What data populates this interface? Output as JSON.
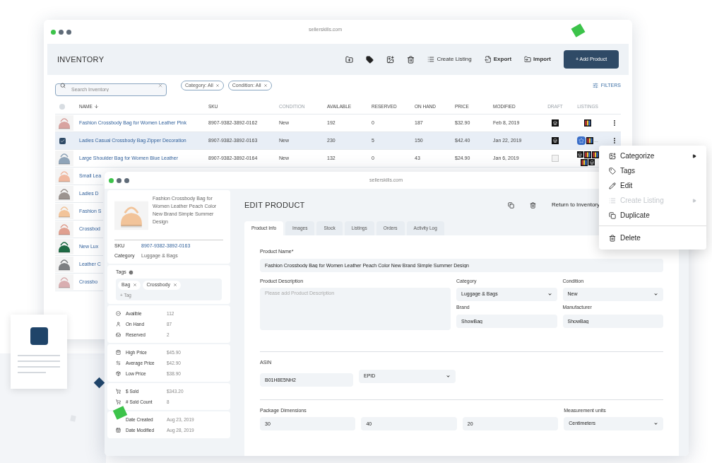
{
  "inventory_window": {
    "address": "sellerskills.com",
    "title": "INVENTORY",
    "toolbar_actions": [
      "Create Listing",
      "Export",
      "Import"
    ],
    "add_button": "+ Add Product",
    "search": {
      "placeholder": "Search Inventory"
    },
    "filter_chips": [
      "Category: All",
      "Condition: All"
    ],
    "filters_button": "FILTERS",
    "all_selected": false,
    "columns": [
      {
        "label": "NAME",
        "sorted": true,
        "dimmed": false
      },
      {
        "label": "SKU",
        "sorted": false,
        "dimmed": false
      },
      {
        "label": "CONDITION",
        "sorted": false,
        "dimmed": true
      },
      {
        "label": "AVAILABLE",
        "sorted": false,
        "dimmed": false
      },
      {
        "label": "RESERVED",
        "sorted": false,
        "dimmed": false
      },
      {
        "label": "ON HAND",
        "sorted": false,
        "dimmed": false
      },
      {
        "label": "PRICE",
        "sorted": false,
        "dimmed": false
      },
      {
        "label": "MODIFIED",
        "sorted": false,
        "dimmed": false
      },
      {
        "label": "DRAFT",
        "sorted": false,
        "dimmed": true
      },
      {
        "label": "LISTINGS",
        "sorted": false,
        "dimmed": true
      }
    ],
    "rows": [
      {
        "name": "Fashion Crossbody Bag for Women Leather Pink",
        "sku": "8907-9382-3892-0162",
        "condition": "New",
        "available": "192",
        "reserved": "0",
        "on_hand": "187",
        "price": "$32.90",
        "modified": "Feb 8, 2019",
        "draft": true,
        "listings": [
          {
            "kind": "stripes"
          }
        ],
        "has_menu": true,
        "selected": false
      },
      {
        "name": "Ladies Casual Crossbody Bag Zipper Decoration",
        "sku": "8907-9382-3892-0163",
        "condition": "New",
        "available": "230",
        "reserved": "5",
        "on_hand": "150",
        "price": "$42.40",
        "modified": "Jan 22, 2019",
        "draft": true,
        "listings": [
          {
            "kind": "star"
          },
          {
            "kind": "stripes"
          }
        ],
        "more": "…",
        "has_menu": true,
        "selected": true
      },
      {
        "name": "Large Shoulder Bag for Women Blue Leather",
        "sku": "8907-9382-3892-0164",
        "condition": "New",
        "available": "132",
        "reserved": "0",
        "on_hand": "43",
        "price": "$24.90",
        "modified": "Jan 6, 2019",
        "draft": false,
        "listings": [
          {
            "kind": "store"
          },
          {
            "kind": "stripes"
          },
          {
            "kind": "stripes"
          },
          {
            "kind": "stripes"
          },
          {
            "kind": "store"
          }
        ],
        "selected": false
      },
      {
        "name": "Small Lea",
        "selected": false
      },
      {
        "name": "Ladies D",
        "selected": false
      },
      {
        "name": "Fashion S",
        "selected": false
      },
      {
        "name": "Crossbod",
        "selected": false
      },
      {
        "name": "New Lux",
        "selected": false
      },
      {
        "name": "Leather C",
        "selected": false
      },
      {
        "name": "Crossbo",
        "selected": false
      }
    ]
  },
  "edit_window": {
    "address": "sellerskills.com",
    "product_title": "Fashion Crossbody Bag for Women Leather Peach Color New Brand Simple Summer Design",
    "sku_label": "SKU",
    "sku": "8907-9382-3892-0163",
    "category_label": "Category",
    "category": "Luggage & Bags",
    "tags_label": "Tags",
    "tags": [
      "Bag",
      "Crossbody"
    ],
    "add_tag": "+ Tag",
    "stat_groups": [
      [
        {
          "label": "Availble",
          "value": "112"
        },
        {
          "label": "On Hand",
          "value": "87"
        },
        {
          "label": "Reserved",
          "value": "2"
        }
      ],
      [
        {
          "label": "High Price",
          "value": "$45.90"
        },
        {
          "label": "Average Price",
          "value": "$42.90"
        },
        {
          "label": "Low Price",
          "value": "$38.90"
        }
      ],
      [
        {
          "label": "$ Sold",
          "value": "$343.20"
        },
        {
          "label": "# Sold Count",
          "value": "8"
        }
      ],
      [
        {
          "label": "Date Created",
          "value": "Aug 23, 2019"
        },
        {
          "label": "Date Modified",
          "value": "Aug 28, 2019"
        }
      ]
    ],
    "title": "EDIT PRODUCT",
    "return_link": "Return to Inventory",
    "tabs": [
      {
        "label": "Product Info",
        "selected": true
      },
      {
        "label": "Images",
        "selected": false
      },
      {
        "label": "Stock",
        "selected": false
      },
      {
        "label": "Listings",
        "selected": false
      },
      {
        "label": "Orders",
        "selected": false
      },
      {
        "label": "Activity Log",
        "selected": false
      }
    ],
    "product_name": {
      "label": "Product Name*",
      "value": "Fashion Crossbody Bag for Women Leather Peach Color New Brand Simple Summer Design"
    },
    "description": {
      "label": "Product Description",
      "placeholder": "Please add Product Description"
    },
    "category_field": {
      "label": "Category",
      "value": "Luggage & Bags"
    },
    "condition_field": {
      "label": "Condition",
      "value": "New"
    },
    "brand": {
      "label": "Brand",
      "value": "ShowBag"
    },
    "manufacturer": {
      "label": "Manufacturer",
      "value": "ShowBag"
    },
    "asin": {
      "label": "ASIN",
      "value": "B01H8E5NH2",
      "type": "EPID"
    },
    "package": {
      "label": "Package Dimensions",
      "values": [
        "30",
        "40",
        "20"
      ]
    },
    "units": {
      "label": "Measurement units",
      "value": "Centimeters"
    }
  },
  "context_menu": [
    {
      "label": "Categorize",
      "kind": "submenu",
      "disabled": false,
      "divider_before": false
    },
    {
      "label": "Tags",
      "kind": "action",
      "disabled": false,
      "divider_before": false
    },
    {
      "label": "Edit",
      "kind": "action",
      "disabled": false,
      "divider_before": false
    },
    {
      "label": "Create Listing",
      "kind": "submenu",
      "disabled": true,
      "divider_before": false
    },
    {
      "label": "Duplicate",
      "kind": "action",
      "disabled": false,
      "divider_before": false
    },
    {
      "label": "Delete",
      "kind": "action",
      "disabled": false,
      "divider_before": true
    }
  ]
}
